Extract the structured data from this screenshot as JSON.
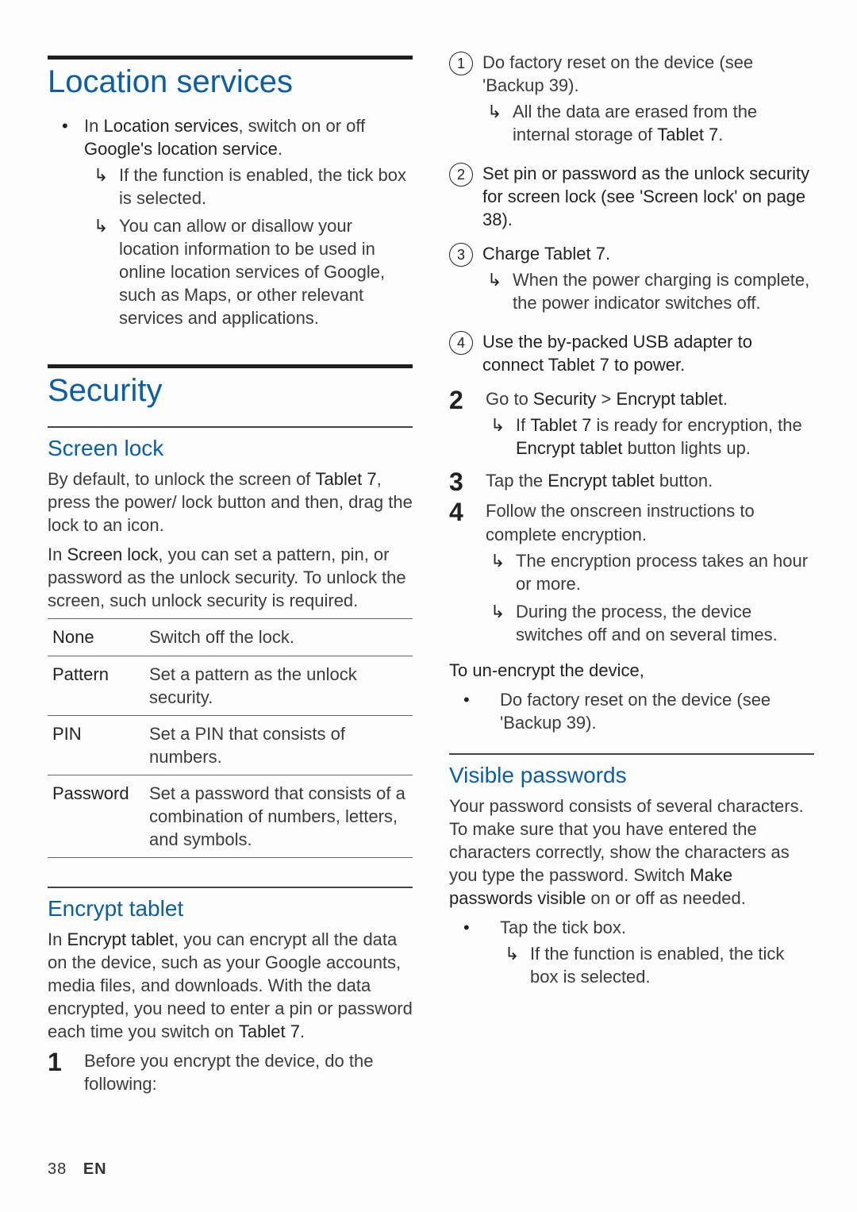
{
  "left": {
    "location": {
      "heading": "Location services",
      "bullet_pre": "In ",
      "bullet_strong1": "Location services",
      "bullet_mid": ", switch on or off ",
      "bullet_strong2": "Google's location service",
      "bullet_post": ".",
      "arrow1": "If the function is enabled, the tick box is selected.",
      "arrow2": "You can allow or disallow your location information to be used in online location services of Google, such as Maps, or other relevant services and applications."
    },
    "security_heading": "Security",
    "screenlock": {
      "heading": "Screen lock",
      "p1_pre": "By default, to unlock the screen of ",
      "p1_dev": "Tablet 7",
      "p1_post": ", press the power/ lock button and then, drag the lock to an icon.",
      "p2_pre": "In ",
      "p2_strong": "Screen lock",
      "p2_post": ", you can set a pattern, pin, or password as the unlock security. To unlock the screen, such unlock security is required.",
      "table": [
        {
          "k": "None",
          "v": "Switch off the lock."
        },
        {
          "k": "Pattern",
          "v": "Set a pattern as the unlock security."
        },
        {
          "k": "PIN",
          "v": "Set a PIN that consists of numbers."
        },
        {
          "k": "Password",
          "v": "Set a password that consists of a combination of numbers, letters, and symbols."
        }
      ]
    },
    "encrypt": {
      "heading": "Encrypt tablet",
      "p_pre": "In ",
      "p_strong": "Encrypt tablet",
      "p_mid": ", you can encrypt all the data on the device, such as your Google accounts, media files, and downloads. With the data encrypted, you need to enter a pin or password each time you switch on ",
      "p_dev": "Tablet 7",
      "p_post": ".",
      "step1": "Before you encrypt the device, do the following:"
    }
  },
  "right": {
    "circ": [
      {
        "n": "1",
        "t_pre": "Do factory reset on the device (see 'Backup 39).",
        "arrows": [
          {
            "pre": "All the data are erased from the internal storage of ",
            "dev": "Tablet 7",
            "post": "."
          }
        ]
      },
      {
        "n": "2",
        "t_pre": "Set pin or password as the unlock security for screen lock (see 'Screen lock' on page 38).",
        "bold_all": true
      },
      {
        "n": "3",
        "t_pre": "Charge ",
        "t_dev": "Tablet 7",
        "t_post": ".",
        "arrows": [
          {
            "pre": "When the power charging is complete, the power indicator switches off."
          }
        ]
      },
      {
        "n": "4",
        "t_pre": "Use the by-packed USB adapter to connect ",
        "t_dev": "Tablet 7",
        "t_post": " to power.",
        "bold_all": true
      }
    ],
    "bigsteps": [
      {
        "n": "2",
        "line_pre": "Go to  ",
        "line_s1": "Security",
        "line_mid": " > ",
        "line_s2": "Encrypt tablet",
        "line_post": ".",
        "arrows": [
          {
            "pre": "If ",
            "dev": "Tablet 7",
            "mid": " is ready for encryption, the ",
            "s": "Encrypt tablet",
            "post": " button lights up."
          }
        ]
      },
      {
        "n": "3",
        "line_pre": "Tap the ",
        "line_s1": "Encrypt tablet",
        "line_post": " button."
      },
      {
        "n": "4",
        "line_pre": "Follow the onscreen instructions to complete encryption.",
        "arrows": [
          {
            "pre": "The encryption process takes an hour or more."
          },
          {
            "pre": "During the process, the device switches off and on several times."
          }
        ]
      }
    ],
    "unencrypt_heading": "To un-encrypt the device,",
    "unencrypt_bullet": "Do factory reset on the device (see 'Backup 39).",
    "visible": {
      "heading": "Visible passwords",
      "p_pre": "Your password consists of several characters. To make sure that you have entered the characters correctly, show the characters as you type the password. Switch ",
      "p_strong": "Make passwords visible",
      "p_post": " on or off as needed.",
      "bullet": "Tap the tick box.",
      "arrow": "If the function is enabled, the tick box is selected."
    }
  },
  "footer": {
    "page": "38",
    "lang": "EN"
  }
}
